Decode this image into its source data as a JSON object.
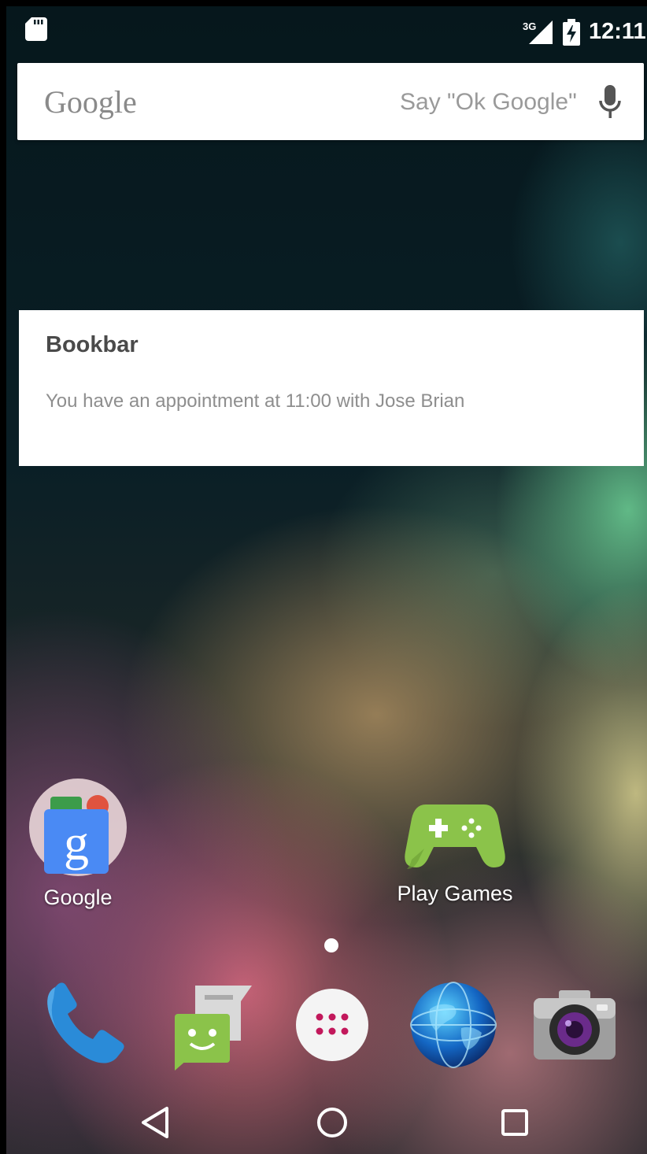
{
  "status_bar": {
    "network": "3G",
    "time": "12:11"
  },
  "search": {
    "logo": "Google",
    "hint": "Say \"Ok Google\""
  },
  "widget": {
    "title": "Bookbar",
    "message": "You have an appointment at 11:00 with Jose Brian"
  },
  "apps": [
    {
      "label": "Google",
      "icon": "google-folder-icon"
    },
    {
      "label": "Play Games",
      "icon": "gamepad-icon"
    }
  ],
  "dock": [
    {
      "icon": "phone-icon"
    },
    {
      "icon": "messaging-icon"
    },
    {
      "icon": "app-drawer-icon"
    },
    {
      "icon": "browser-globe-icon"
    },
    {
      "icon": "camera-icon"
    }
  ],
  "colors": {
    "play_games_green": "#8bc34a",
    "google_blue": "#4a8af4"
  }
}
